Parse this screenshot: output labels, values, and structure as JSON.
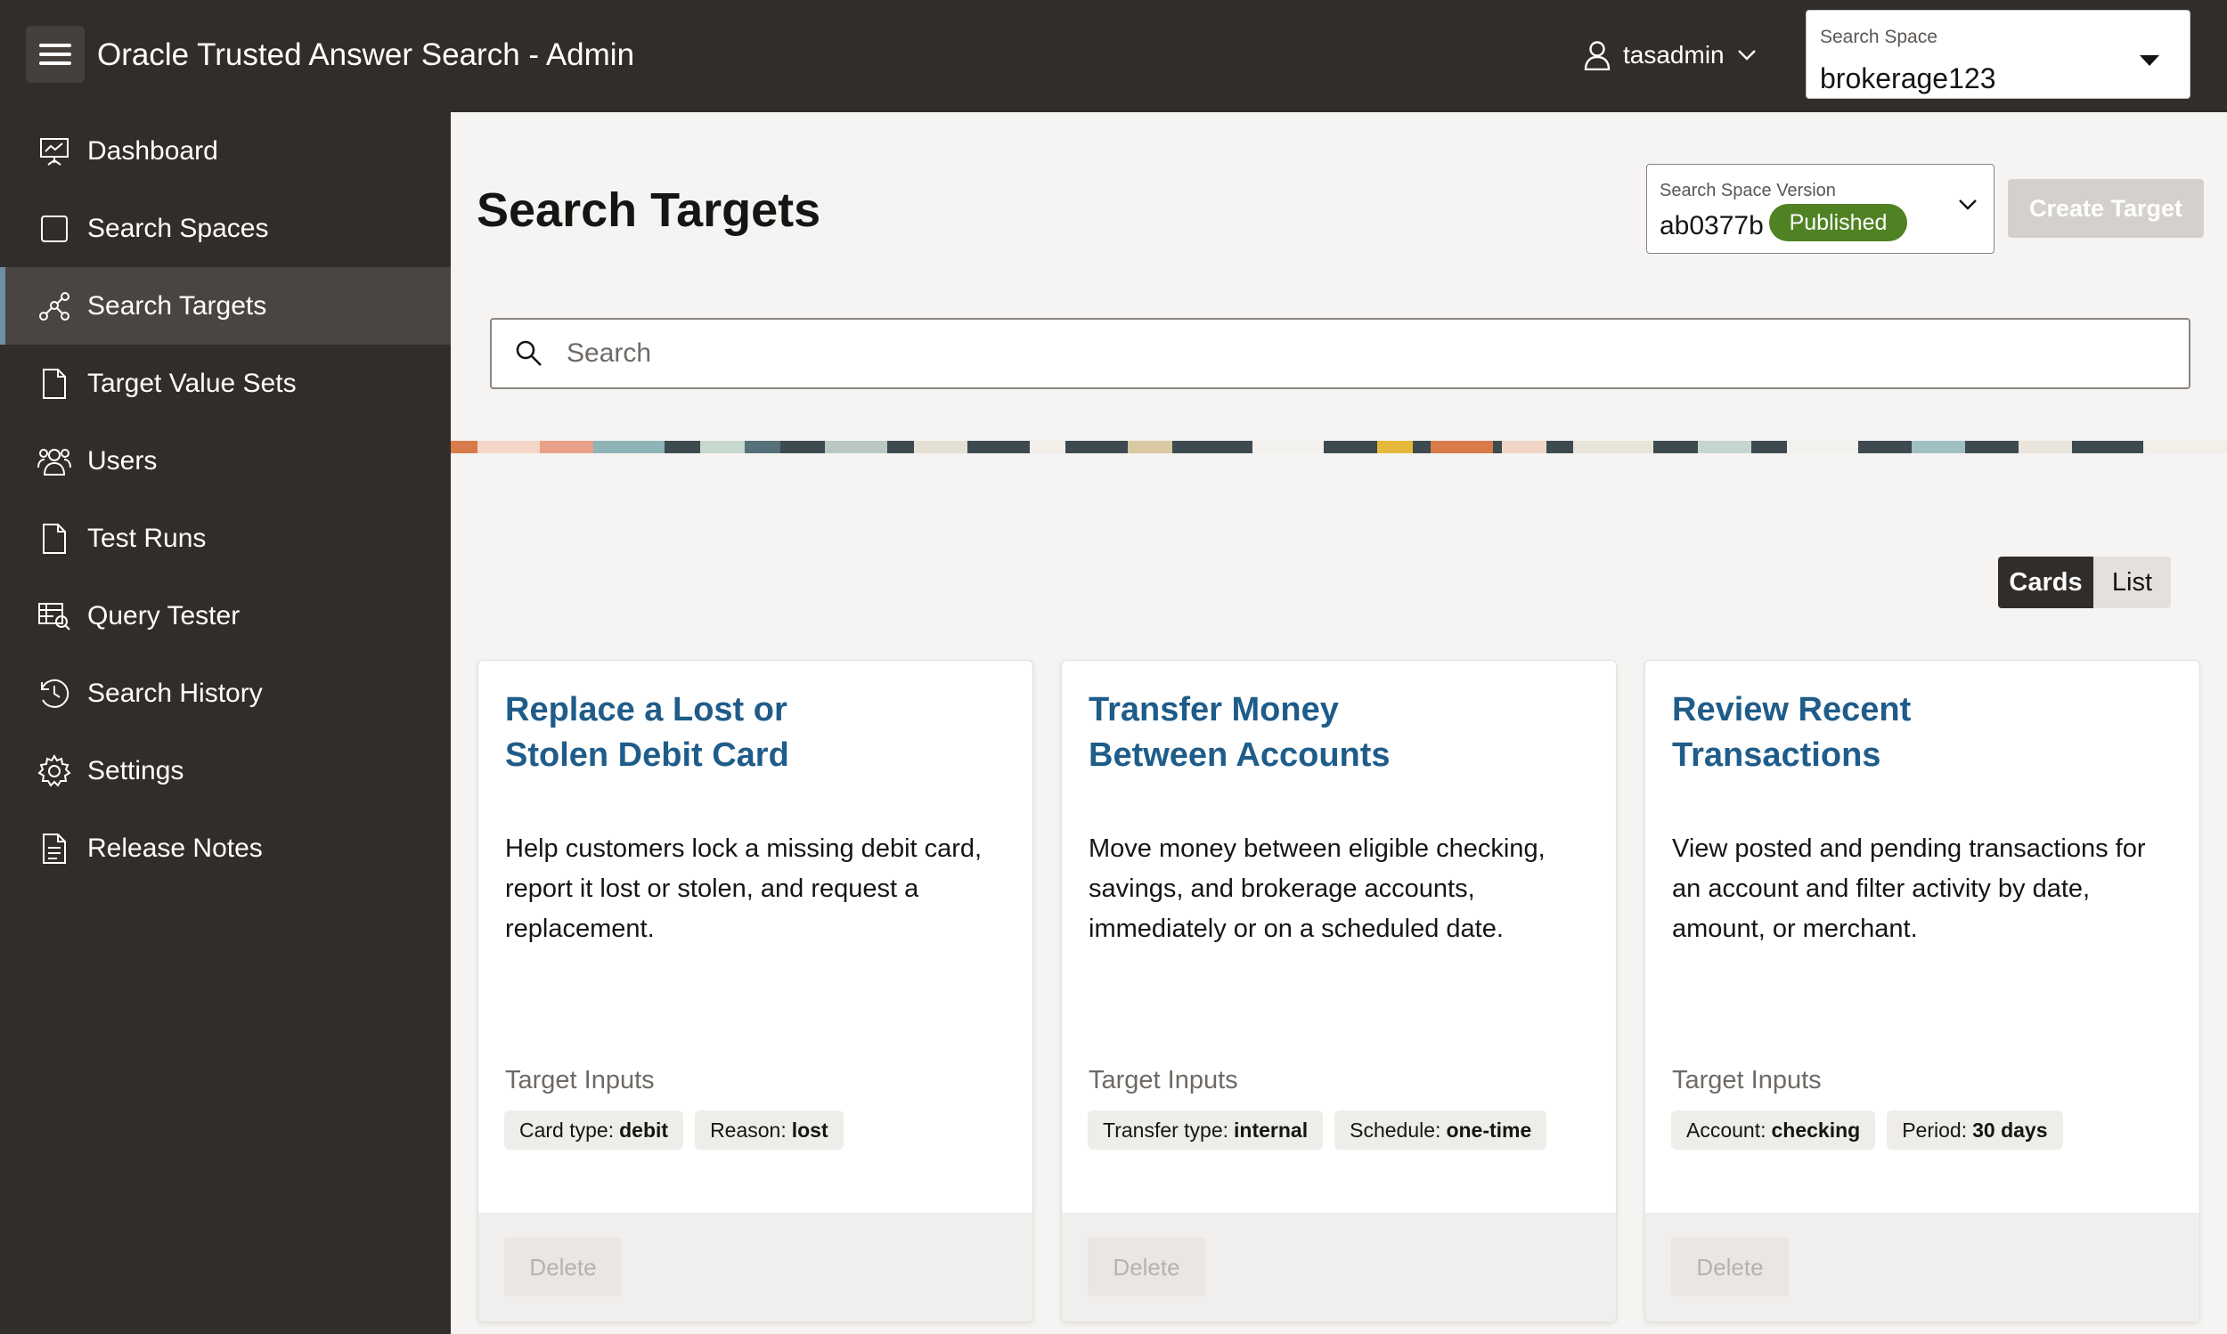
{
  "header": {
    "app_title": "Oracle Trusted Answer Search - Admin",
    "username": "tasadmin",
    "search_space": {
      "label": "Search Space",
      "value": "brokerage123"
    }
  },
  "sidebar": {
    "items": [
      {
        "label": "Dashboard",
        "icon": "presentation-icon",
        "active": false
      },
      {
        "label": "Search Spaces",
        "icon": "square-icon",
        "active": false
      },
      {
        "label": "Search Targets",
        "icon": "target-network-icon",
        "active": true
      },
      {
        "label": "Target Value Sets",
        "icon": "document-icon",
        "active": false
      },
      {
        "label": "Users",
        "icon": "users-icon",
        "active": false
      },
      {
        "label": "Test Runs",
        "icon": "document-icon",
        "active": false
      },
      {
        "label": "Query Tester",
        "icon": "query-table-icon",
        "active": false
      },
      {
        "label": "Search History",
        "icon": "history-icon",
        "active": false
      },
      {
        "label": "Settings",
        "icon": "gear-icon",
        "active": false
      },
      {
        "label": "Release Notes",
        "icon": "notes-icon",
        "active": false
      }
    ]
  },
  "main": {
    "title": "Search Targets",
    "version": {
      "label": "Search Space Version",
      "value": "ab0377b",
      "status": "Published"
    },
    "create_label": "Create Target",
    "search_placeholder": "Search",
    "view_toggle": {
      "cards": "Cards",
      "list": "List",
      "selected": "Cards"
    },
    "cards": [
      {
        "title": "Replace a Lost or Stolen Debit Card",
        "description": "Help customers lock a missing debit card, report it lost or stolen, and request a replacement.",
        "inputs_label": "Target Inputs",
        "chips": [
          {
            "key": "Card type:",
            "value": "debit"
          },
          {
            "key": "Reason:",
            "value": "lost"
          }
        ],
        "delete_label": "Delete"
      },
      {
        "title": "Transfer Money Between Accounts",
        "description": "Move money between eligible checking, savings, and brokerage accounts, immediately or on a scheduled date.",
        "inputs_label": "Target Inputs",
        "chips": [
          {
            "key": "Transfer type:",
            "value": "internal"
          },
          {
            "key": "Schedule:",
            "value": "one-time"
          }
        ],
        "delete_label": "Delete"
      },
      {
        "title": "Review Recent Transactions",
        "description": "View posted and pending transactions for an account and filter activity by date, amount, or merchant.",
        "inputs_label": "Target Inputs",
        "chips": [
          {
            "key": "Account:",
            "value": "checking"
          },
          {
            "key": "Period:",
            "value": "30 days"
          }
        ],
        "delete_label": "Delete"
      }
    ]
  },
  "colors": {
    "header_bg": "#312d2a",
    "active_nav_bg": "#4a4541",
    "card_title": "#1f5c8a",
    "published_badge": "#508223"
  }
}
